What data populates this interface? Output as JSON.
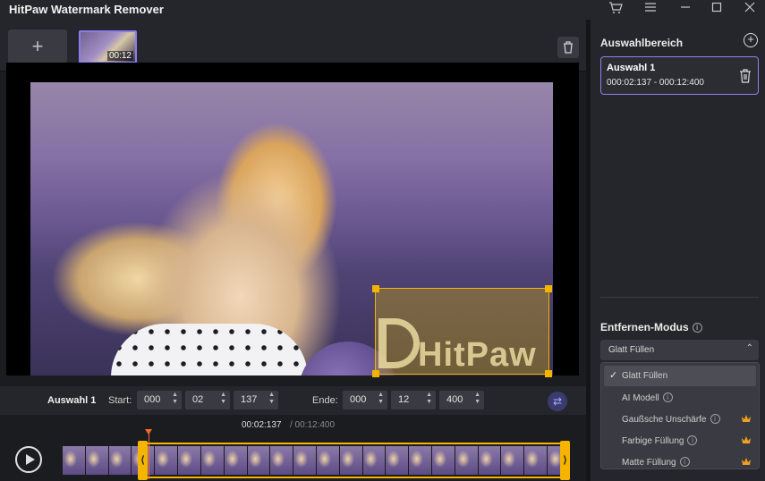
{
  "app": {
    "title": "HitPaw Watermark Remover",
    "window_controls": [
      "cart-icon",
      "menu-icon",
      "minimize-icon",
      "maximize-icon",
      "close-icon"
    ]
  },
  "toolbar": {
    "add_label": "+",
    "thumbnail_duration": "00:12"
  },
  "preview": {
    "watermark_text": "HitPaw"
  },
  "time_controls": {
    "selection_label": "Auswahl 1",
    "start_label": "Start:",
    "start": [
      "000",
      "02",
      "137"
    ],
    "end_label": "Ende:",
    "end": [
      "000",
      "12",
      "400"
    ]
  },
  "timeline": {
    "current_time": "00:02:137",
    "total_time": "/ 00:12:400"
  },
  "right_panel": {
    "selection_area_title": "Auswahlbereich",
    "selection": {
      "title": "Auswahl 1",
      "range": "000:02:137 - 000:12:400"
    },
    "mode_title": "Entfernen-Modus",
    "selected_mode": "Glatt Füllen",
    "modes": [
      {
        "label": "Glatt Füllen",
        "selected": true,
        "info": false,
        "premium": false
      },
      {
        "label": "AI Modell",
        "selected": false,
        "info": true,
        "premium": false
      },
      {
        "label": "Gaußsche Unschärfe",
        "selected": false,
        "info": true,
        "premium": true
      },
      {
        "label": "Farbige Füllung",
        "selected": false,
        "info": true,
        "premium": true
      },
      {
        "label": "Matte Füllung",
        "selected": false,
        "info": true,
        "premium": true
      }
    ]
  },
  "colors": {
    "accent": "#8c84e8",
    "selection": "#f3b400",
    "playhead": "#ff6a2b",
    "crown": "#f0a020"
  }
}
